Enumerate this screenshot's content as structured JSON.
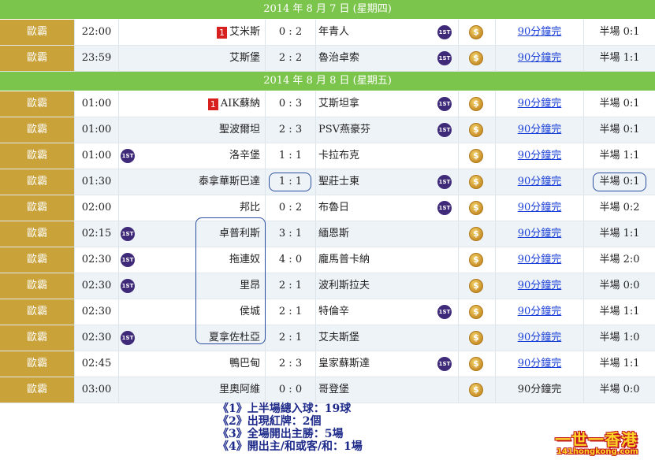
{
  "colors": {
    "date_bar": "#7cc54d",
    "league_cell": "#c9a23a",
    "row_alt": "#eef3f8",
    "red_card": "#d8201e",
    "link": "#1a3fd6",
    "annotation": "#1d2a8a",
    "badge": "#3f2a7a"
  },
  "icons": {
    "first_half_badge": "1st-badge-icon",
    "odds": "dollar-coin-icon",
    "red_card": "red-card-icon"
  },
  "sections": [
    {
      "date": "2014 年 8 月 7 日 (星期四)",
      "matches": [
        {
          "league": "歐霸",
          "time": "22:00",
          "home_red": "1",
          "home": "艾米斯",
          "home_1st": false,
          "score": "0 : 2",
          "away": "年青人",
          "away_1st": true,
          "result_link": "90分鐘完",
          "link_underlined": true,
          "half": "半場 0:1"
        },
        {
          "league": "歐霸",
          "time": "23:59",
          "home_red": "",
          "home": "艾斯堡",
          "home_1st": false,
          "score": "2 : 2",
          "away": "魯治卓索",
          "away_1st": true,
          "result_link": "90分鐘完",
          "link_underlined": true,
          "half": "半場 1:1"
        }
      ]
    },
    {
      "date": "2014 年 8 月 8 日 (星期五)",
      "matches": [
        {
          "league": "歐霸",
          "time": "01:00",
          "home_red": "1",
          "home": "AIK蘇納",
          "home_1st": false,
          "score": "0 : 3",
          "away": "艾斯坦拿",
          "away_1st": true,
          "result_link": "90分鐘完",
          "link_underlined": true,
          "half": "半場 0:1"
        },
        {
          "league": "歐霸",
          "time": "01:00",
          "home_red": "",
          "home": "聖波爾坦",
          "home_1st": false,
          "score": "2 : 3",
          "away": "PSV燕豪芬",
          "away_1st": true,
          "result_link": "90分鐘完",
          "link_underlined": true,
          "half": "半場 0:1"
        },
        {
          "league": "歐霸",
          "time": "01:00",
          "home_red": "",
          "home": "洛辛堡",
          "home_1st": true,
          "score": "1 : 1",
          "away": "卡拉布克",
          "away_1st": false,
          "result_link": "90分鐘完",
          "link_underlined": true,
          "half": "半場 1:1"
        },
        {
          "league": "歐霸",
          "time": "01:30",
          "home_red": "",
          "home": "泰拿華斯巴達",
          "home_1st": false,
          "score": "1 : 1",
          "away": "聖莊士東",
          "away_1st": true,
          "result_link": "90分鐘完",
          "link_underlined": true,
          "half": "半場 0:1",
          "circled": true
        },
        {
          "league": "歐霸",
          "time": "02:00",
          "home_red": "",
          "home": "邦比",
          "home_1st": false,
          "score": "0 : 2",
          "away": "布魯日",
          "away_1st": true,
          "result_link": "90分鐘完",
          "link_underlined": true,
          "half": "半場 0:2"
        },
        {
          "league": "歐霸",
          "time": "02:15",
          "home_red": "",
          "home": "卓普利斯",
          "home_1st": true,
          "score": "3 : 1",
          "away": "緬恩斯",
          "away_1st": false,
          "result_link": "90分鐘完",
          "link_underlined": true,
          "half": "半場 1:1"
        },
        {
          "league": "歐霸",
          "time": "02:30",
          "home_red": "",
          "home": "拖連奴",
          "home_1st": true,
          "score": "4 : 0",
          "away": "龐馬普卡納",
          "away_1st": false,
          "result_link": "90分鐘完",
          "link_underlined": true,
          "half": "半場 2:0"
        },
        {
          "league": "歐霸",
          "time": "02:30",
          "home_red": "",
          "home": "里昂",
          "home_1st": true,
          "score": "2 : 1",
          "away": "波利斯拉夫",
          "away_1st": false,
          "result_link": "90分鐘完",
          "link_underlined": true,
          "half": "半場 0:0"
        },
        {
          "league": "歐霸",
          "time": "02:30",
          "home_red": "",
          "home": "侯城",
          "home_1st": false,
          "score": "2 : 1",
          "away": "特倫辛",
          "away_1st": true,
          "result_link": "90分鐘完",
          "link_underlined": true,
          "half": "半場 1:1"
        },
        {
          "league": "歐霸",
          "time": "02:30",
          "home_red": "",
          "home": "夏拿佐杜亞",
          "home_1st": true,
          "score": "2 : 1",
          "away": "艾夫斯堡",
          "away_1st": false,
          "result_link": "90分鐘完",
          "link_underlined": true,
          "half": "半場 1:0"
        },
        {
          "league": "歐霸",
          "time": "02:45",
          "home_red": "",
          "home": "鴨巴甸",
          "home_1st": false,
          "score": "2 : 3",
          "away": "皇家蘇斯達",
          "away_1st": true,
          "result_link": "90分鐘完",
          "link_underlined": true,
          "half": "半場 1:1"
        },
        {
          "league": "歐霸",
          "time": "03:00",
          "home_red": "",
          "home": "里奧阿維",
          "home_1st": false,
          "score": "0 : 0",
          "away": "哥登堡",
          "away_1st": false,
          "result_link": "90分鐘完",
          "link_underlined": false,
          "half": "半場 0:0"
        }
      ]
    }
  ],
  "stats": [
    "《1》上半場總入球：19球",
    "《2》出現紅牌：2個",
    "《3》全場開出主勝：5場",
    "《4》開出主/和或客/和：1場"
  ],
  "logo": {
    "main": "一世一香港",
    "sub": "141hongkong.com"
  }
}
